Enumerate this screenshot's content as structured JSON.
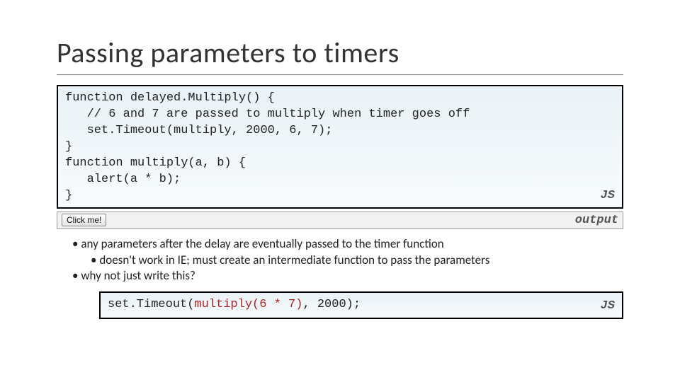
{
  "title": "Passing parameters to timers",
  "code1": {
    "lines": [
      "function delayed.Multiply() {",
      "   // 6 and 7 are passed to multiply when timer goes off",
      "   set.Timeout(multiply, 2000, 6, 7);",
      "}",
      "function multiply(a, b) {",
      "   alert(a * b);",
      "}"
    ],
    "lang": "JS"
  },
  "output": {
    "button_label": "Click me!",
    "label": "output"
  },
  "bullets": {
    "b1": "any parameters after the delay are eventually passed to the timer function",
    "b1a": "doesn't work in IE; must create an intermediate function to pass the parameters",
    "b2": "why not just write this?"
  },
  "code2": {
    "prefix": "set.Timeout(",
    "highlight": "multiply(6 * 7)",
    "suffix": ", 2000);",
    "lang": "JS"
  }
}
